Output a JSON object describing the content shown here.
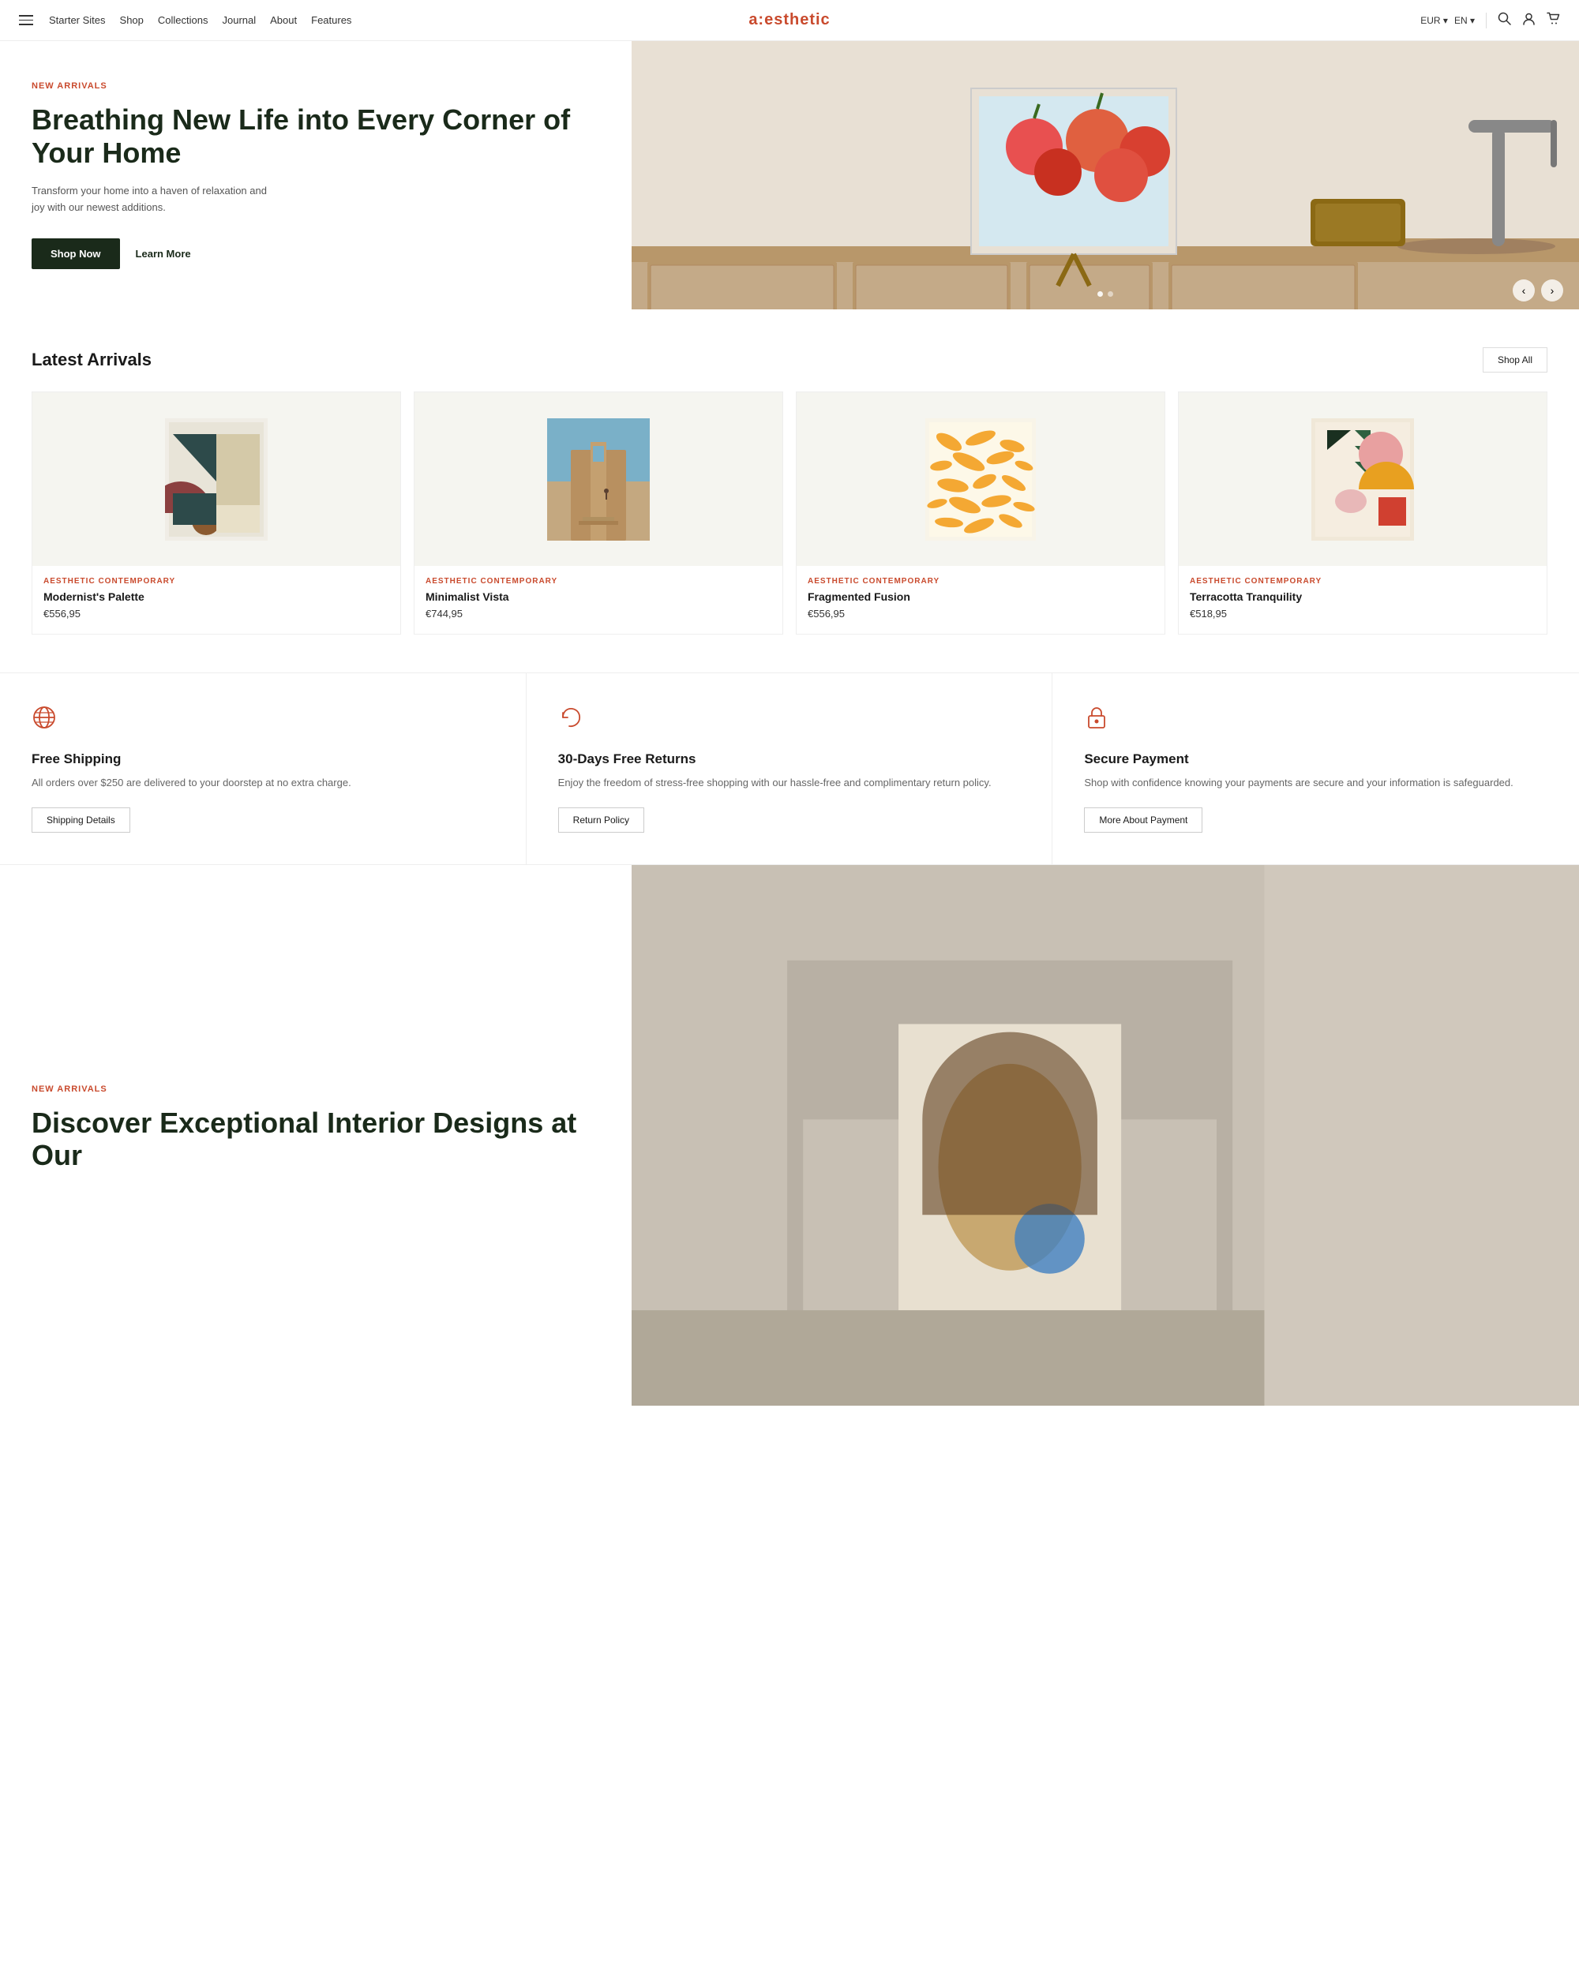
{
  "nav": {
    "hamburger_label": "menu",
    "links": [
      {
        "label": "Starter Sites",
        "href": "#"
      },
      {
        "label": "Shop",
        "href": "#"
      },
      {
        "label": "Collections",
        "href": "#"
      },
      {
        "label": "Journal",
        "href": "#"
      },
      {
        "label": "About",
        "href": "#"
      },
      {
        "label": "Features",
        "href": "#"
      }
    ],
    "brand": "a:esthetic",
    "currency": "EUR",
    "language": "EN",
    "currency_arrow": "▾",
    "lang_arrow": "▾"
  },
  "hero": {
    "badge": "NEW ARRIVALS",
    "title": "Breathing New Life into Every Corner of Your Home",
    "description": "Transform your home into a haven of relaxation and joy with our newest additions.",
    "shop_now": "Shop Now",
    "learn_more": "Learn More"
  },
  "latest_arrivals": {
    "section_title": "Latest Arrivals",
    "shop_all": "Shop All",
    "products": [
      {
        "category": "AESTHETIC CONTEMPORARY",
        "name": "Modernist's Palette",
        "price": "€556,95"
      },
      {
        "category": "AESTHETIC CONTEMPORARY",
        "name": "Minimalist Vista",
        "price": "€744,95"
      },
      {
        "category": "AESTHETIC CONTEMPORARY",
        "name": "Fragmented Fusion",
        "price": "€556,95"
      },
      {
        "category": "AESTHETIC CONTEMPORARY",
        "name": "Terracotta Tranquility",
        "price": "€518,95"
      }
    ]
  },
  "features": [
    {
      "icon": "globe",
      "title": "Free Shipping",
      "description": "All orders over $250 are delivered to your doorstep at no extra charge.",
      "button_label": "Shipping Details"
    },
    {
      "icon": "return",
      "title": "30-Days Free Returns",
      "description": "Enjoy the freedom of stress-free shopping with our hassle-free and complimentary return policy.",
      "button_label": "Return Policy"
    },
    {
      "icon": "lock",
      "title": "Secure Payment",
      "description": "Shop with confidence knowing your payments are secure and your information is safeguarded.",
      "button_label": "More About Payment"
    }
  ],
  "hero2": {
    "badge": "NEW ARRIVALS",
    "title": "Discover Exceptional Interior Designs at Our"
  }
}
